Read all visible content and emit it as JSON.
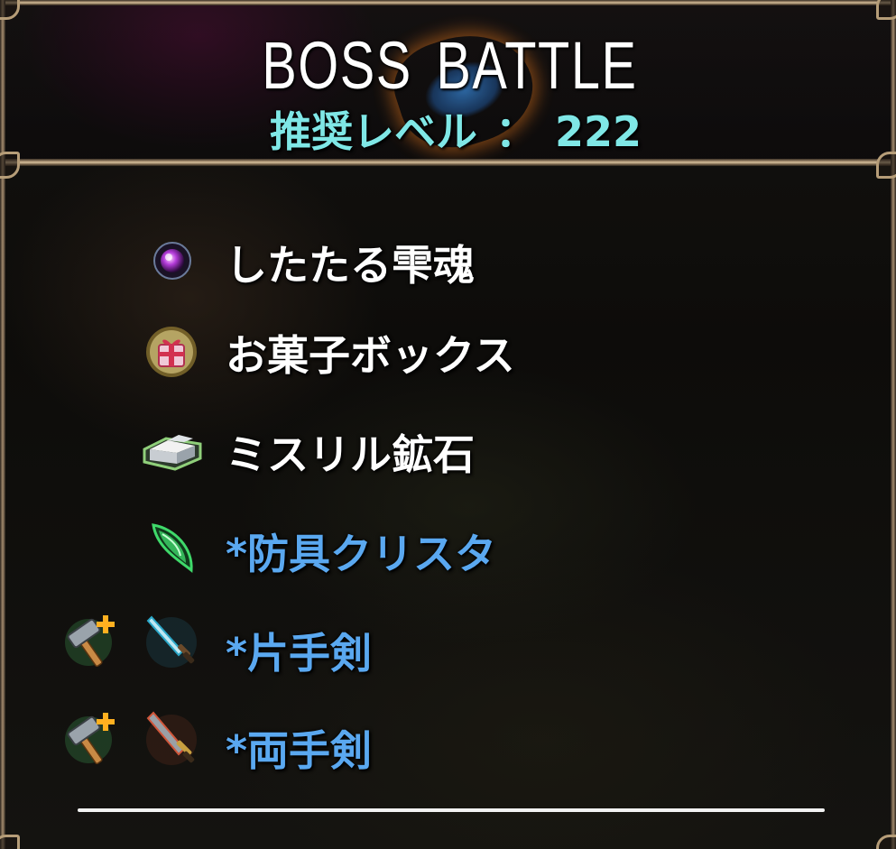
{
  "header": {
    "title_left": "BOSS",
    "title_right": "BATTLE",
    "level_label": "推奨レベル",
    "level_separator": "：",
    "level_value": "222"
  },
  "drops": [
    {
      "label": "したたる雫魂",
      "icon": "soul-orb-icon",
      "color": "#ffffff",
      "upgrade_icon": false
    },
    {
      "label": "お菓子ボックス",
      "icon": "gift-box-icon",
      "color": "#ffffff",
      "upgrade_icon": false
    },
    {
      "label": "ミスリル鉱石",
      "icon": "mithril-ore-icon",
      "color": "#ffffff",
      "upgrade_icon": false
    },
    {
      "label": "*防具クリスタ",
      "icon": "green-crystal-icon",
      "color": "#5aa8f0",
      "upgrade_icon": false
    },
    {
      "label": "*片手剣",
      "icon": "one-handed-sword-icon",
      "color": "#5aa8f0",
      "upgrade_icon": true
    },
    {
      "label": "*両手剣",
      "icon": "two-handed-sword-icon",
      "color": "#5aa8f0",
      "upgrade_icon": true
    }
  ],
  "colors": {
    "title": "#ffffff",
    "level": "#7fe7e6",
    "item_normal": "#ffffff",
    "item_equipment": "#5aa8f0",
    "frame": "#b69d78"
  }
}
